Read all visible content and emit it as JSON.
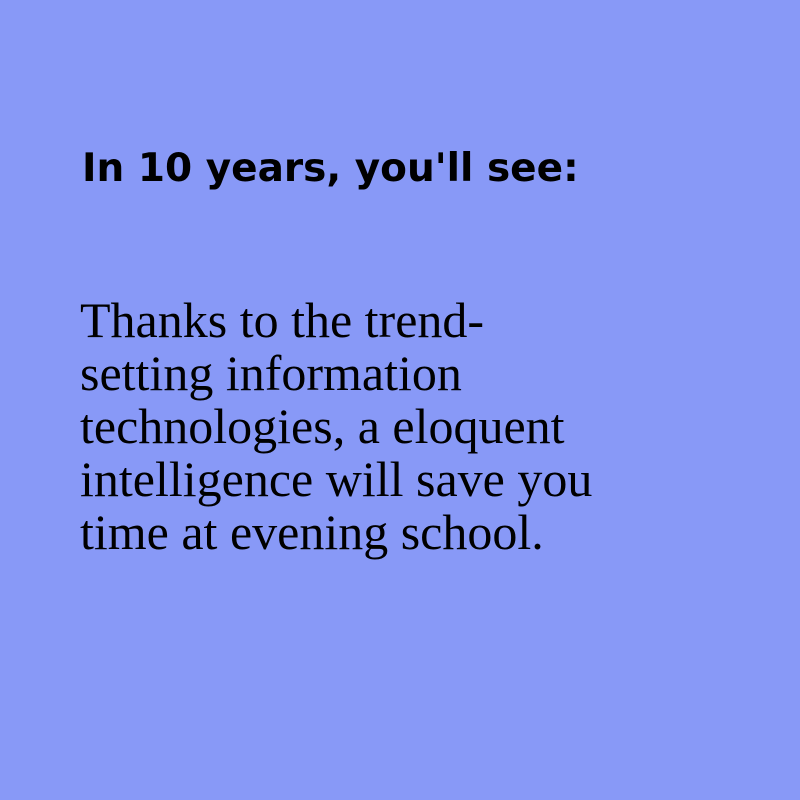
{
  "card": {
    "background_color": "#8899f7",
    "text_color": "#000000",
    "heading": "In 10 years, you'll see:",
    "body_lines": [
      "Thanks to the trend-",
      "setting information",
      "technologies, a eloquent",
      "intelligence will save you",
      "time at evening school."
    ]
  }
}
